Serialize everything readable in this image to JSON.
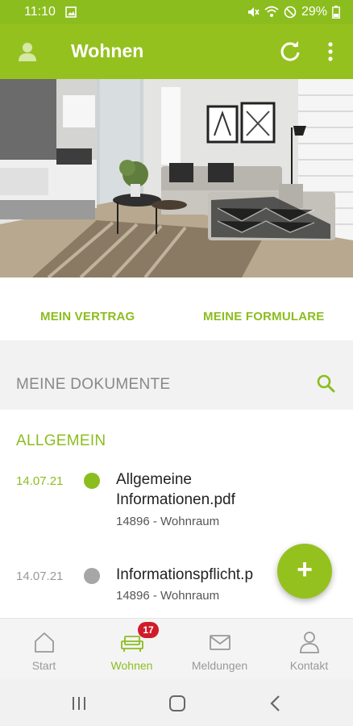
{
  "status_bar": {
    "time": "11:10",
    "battery": "29%",
    "icons": [
      "image-icon",
      "mute-icon",
      "wifi-icon",
      "do-not-disturb-icon",
      "battery-icon"
    ]
  },
  "app_bar": {
    "title": "Wohnen",
    "icons": [
      "account-icon",
      "refresh-icon",
      "more-vert-icon"
    ]
  },
  "hero": {
    "description_icon": "apartment-photo"
  },
  "tabs": {
    "vertrag": "MEIN VERTRAG",
    "formulare": "MEINE FORMULARE"
  },
  "documents": {
    "header": "MEINE DOKUMENTE",
    "section_title": "ALLGEMEIN",
    "items": [
      {
        "date": "14.07.21",
        "name": "Allgemeine Informationen.pdf",
        "sub": "14896 - Wohnraum",
        "status_color": "#8cbd1f"
      },
      {
        "date": "14.07.21",
        "name": "Informationspflicht.p",
        "sub": "14896 - Wohnraum",
        "status_color": "#a6a6a6"
      }
    ]
  },
  "fab": {
    "label": "+",
    "icon": "add-icon"
  },
  "bottom_nav": {
    "items": [
      {
        "label": "Start",
        "icon": "home-icon"
      },
      {
        "label": "Wohnen",
        "icon": "sofa-icon",
        "badge": "17"
      },
      {
        "label": "Meldungen",
        "icon": "mail-icon"
      },
      {
        "label": "Kontakt",
        "icon": "person-icon"
      }
    ]
  },
  "colors": {
    "primary": "#95c11f",
    "accent_text": "#8cbd1f",
    "badge": "#d01b2a"
  }
}
